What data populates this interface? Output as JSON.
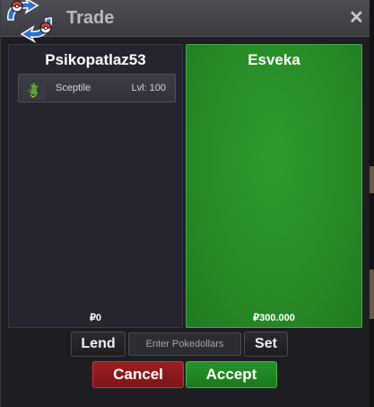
{
  "window": {
    "title": "Trade",
    "close_icon": "close-icon",
    "logo_icon": "pokeball-swap-icon"
  },
  "trade": {
    "left": {
      "player": "Psikopatlaz53",
      "money": "₽0",
      "items": [
        {
          "icon": "sceptile-sprite-icon",
          "name": "Sceptile",
          "level": "Lvl: 100"
        }
      ]
    },
    "right": {
      "player": "Esveka",
      "money": "₽300.000"
    }
  },
  "controls": {
    "lend_label": "Lend",
    "pokedollars_placeholder": "Enter Pokedollars",
    "set_label": "Set",
    "cancel_label": "Cancel",
    "accept_label": "Accept"
  },
  "colors": {
    "accept_panel": "#2a9030",
    "cancel": "#8e1b1e",
    "accept": "#24902a"
  }
}
